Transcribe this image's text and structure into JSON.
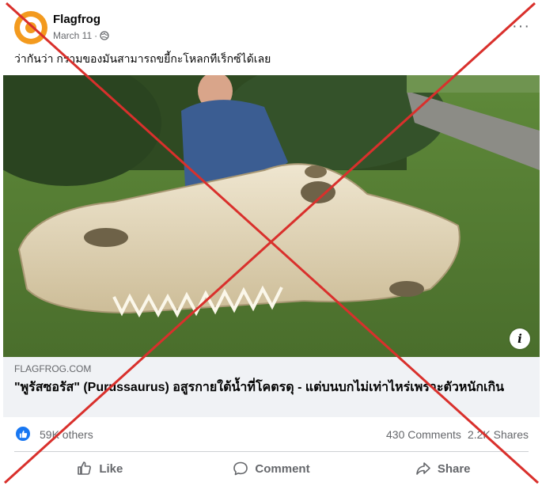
{
  "post": {
    "page_name": "Flagfrog",
    "date": "March 11",
    "separator": "·",
    "caption": "ว่ากันว่า กรามของมันสามารถขยี้กะโหลกทีเร็กซ์ได้เลย",
    "more_label": "···"
  },
  "link": {
    "domain": "FLAGFROG.COM",
    "title": "\"พูรัสซอรัส\" (Purussaurus) อสูรกายใต้น้ำที่โคตรดุ - แต่บนบกไม่เท่าไหร่เพราะตัวหนักเกิน"
  },
  "photo": {
    "info_label": "i"
  },
  "stats": {
    "reactions": "59K others",
    "comments": "430 Comments",
    "shares": "2.2K Shares"
  },
  "actions": {
    "like": "Like",
    "comment": "Comment",
    "share": "Share"
  },
  "colors": {
    "brand_orange": "#f39a1e",
    "facebook_blue": "#1877f2",
    "cross_red": "#d9302c"
  }
}
